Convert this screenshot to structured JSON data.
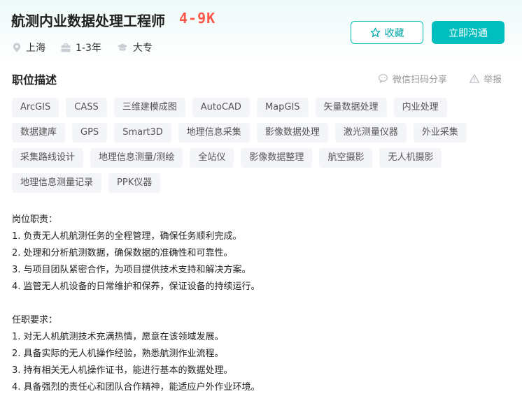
{
  "job": {
    "title": "航测内业数据处理工程师",
    "salary": "4-9K",
    "location": "上海",
    "experience": "1-3年",
    "education": "大专"
  },
  "actions": {
    "collect_label": "收藏",
    "chat_label": "立即沟通"
  },
  "section": {
    "title": "职位描述",
    "share_label": "微信扫码分享",
    "report_label": "举报"
  },
  "tags": [
    "ArcGIS",
    "CASS",
    "三维建模成图",
    "AutoCAD",
    "MapGIS",
    "矢量数据处理",
    "内业处理",
    "数据建库",
    "GPS",
    "Smart3D",
    "地理信息采集",
    "影像数据处理",
    "激光测量仪器",
    "外业采集",
    "采集路线设计",
    "地理信息测量/测绘",
    "全站仪",
    "影像数据整理",
    "航空摄影",
    "无人机摄影",
    "地理信息测量记录",
    "PPK仪器"
  ],
  "description": {
    "duties_heading": "岗位职责：",
    "duties": [
      "1. 负责无人机航测任务的全程管理，确保任务顺利完成。",
      "2. 处理和分析航测数据，确保数据的准确性和可靠性。",
      "3. 与项目团队紧密合作，为项目提供技术支持和解决方案。",
      "4. 监管无人机设备的日常维护和保养，保证设备的持续运行。"
    ],
    "requirements_heading": "任职要求：",
    "requirements": [
      "1. 对无人机航测技术充满热情，愿意在该领域发展。",
      "2. 具备实际的无人机操作经验，熟悉航测作业流程。",
      "3. 持有相关无人机操作证书，能进行基本的数据处理。",
      "4. 具备强烈的责任心和团队合作精神，能适应户外作业环境。"
    ]
  },
  "icons": {
    "location": "location-pin-icon",
    "experience": "briefcase-icon",
    "education": "graduation-cap-icon",
    "collect": "star-icon",
    "share": "wechat-icon",
    "report": "warning-icon"
  },
  "colors": {
    "accent": "#00bebd",
    "salary": "#fe574a",
    "tag_bg": "#f3f5f8"
  }
}
